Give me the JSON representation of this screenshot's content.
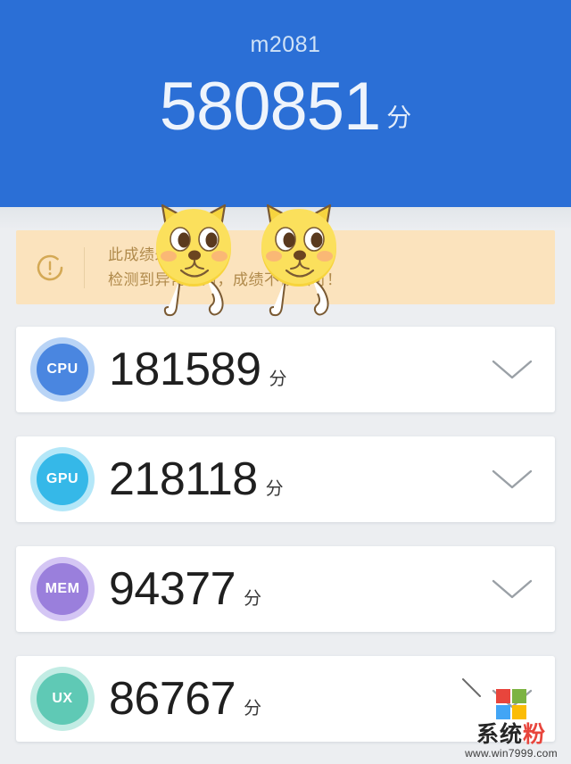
{
  "header": {
    "device_name": "m2081",
    "total_score": "580851",
    "score_unit": "分",
    "background_color": "#2b6fd6"
  },
  "warning_banner": {
    "icon": "exclamation-circle-icon",
    "line1": "此成绩未经验证",
    "line2": "检测到异常行为，成绩不被认可！",
    "background_color": "#fbe3bd",
    "text_color": "#b08a4b"
  },
  "score_cards": [
    {
      "badge_label": "CPU",
      "badge_color": "#4a86e0",
      "badge_ring_color": "#b9d4f6",
      "score": "181589",
      "unit": "分",
      "chevron": "chevron-down-icon"
    },
    {
      "badge_label": "GPU",
      "badge_color": "#35b8e8",
      "badge_ring_color": "#b4e7f8",
      "score": "218118",
      "unit": "分",
      "chevron": "chevron-down-icon"
    },
    {
      "badge_label": "MEM",
      "badge_color": "#9a7fdc",
      "badge_ring_color": "#d4c6f4",
      "score": "94377",
      "unit": "分",
      "chevron": "chevron-down-icon"
    },
    {
      "badge_label": "UX",
      "badge_color": "#5fc9b5",
      "badge_ring_color": "#c2ece4",
      "score": "86767",
      "unit": "分",
      "chevron": "chevron-down-icon"
    }
  ],
  "stickers": [
    {
      "name": "yellow-dog-sticker-left"
    },
    {
      "name": "yellow-dog-sticker-right"
    }
  ],
  "watermark": {
    "title_part1": "系统",
    "title_part2": "粉",
    "url": "www.win7999.com",
    "square_colors": [
      "#e8453c",
      "#7cb342",
      "#42a5f5",
      "#fbbc05"
    ]
  }
}
